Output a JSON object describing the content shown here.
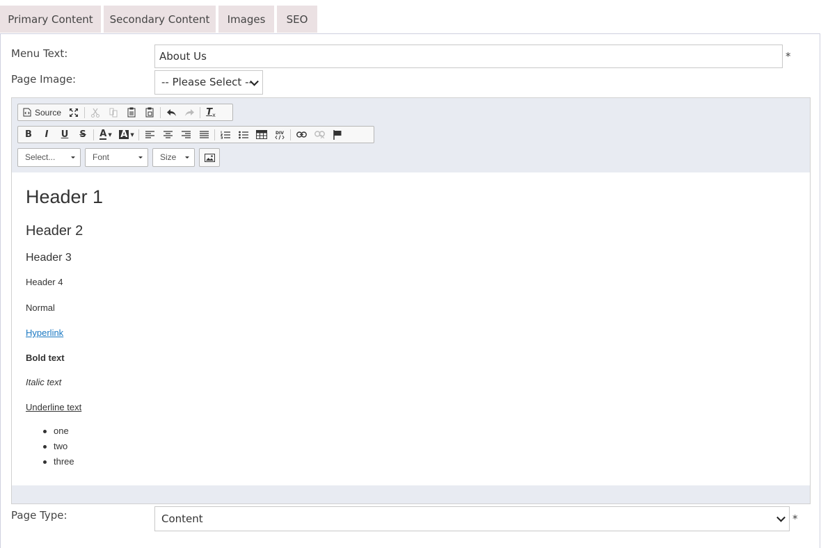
{
  "tabs": [
    {
      "label": "Primary Content"
    },
    {
      "label": "Secondary Content"
    },
    {
      "label": "Images"
    },
    {
      "label": "SEO"
    }
  ],
  "form": {
    "menu_text_label": "Menu Text:",
    "menu_text_value": "About Us",
    "required_mark": "*",
    "page_image_label": "Page Image:",
    "page_image_value": "-- Please Select --",
    "page_type_label": "Page Type:",
    "page_type_value": "Content"
  },
  "editor": {
    "toolbar": {
      "source_label": "Source",
      "format_combo": "Select...",
      "font_combo": "Font",
      "size_combo": "Size",
      "buttons": {
        "bold": "B",
        "italic": "I",
        "underline": "U",
        "strike": "S",
        "text_color": "A",
        "bg_color": "A",
        "remove_format": "T"
      }
    },
    "content": {
      "h1": "Header 1",
      "h2": "Header 2",
      "h3": "Header 3",
      "h4": "Header 4",
      "normal": "Normal",
      "hyperlink": "Hyperlink",
      "bold": "Bold text",
      "italic": "Italic text",
      "underline": "Underline text",
      "list": [
        "one",
        "two",
        "three"
      ]
    }
  }
}
